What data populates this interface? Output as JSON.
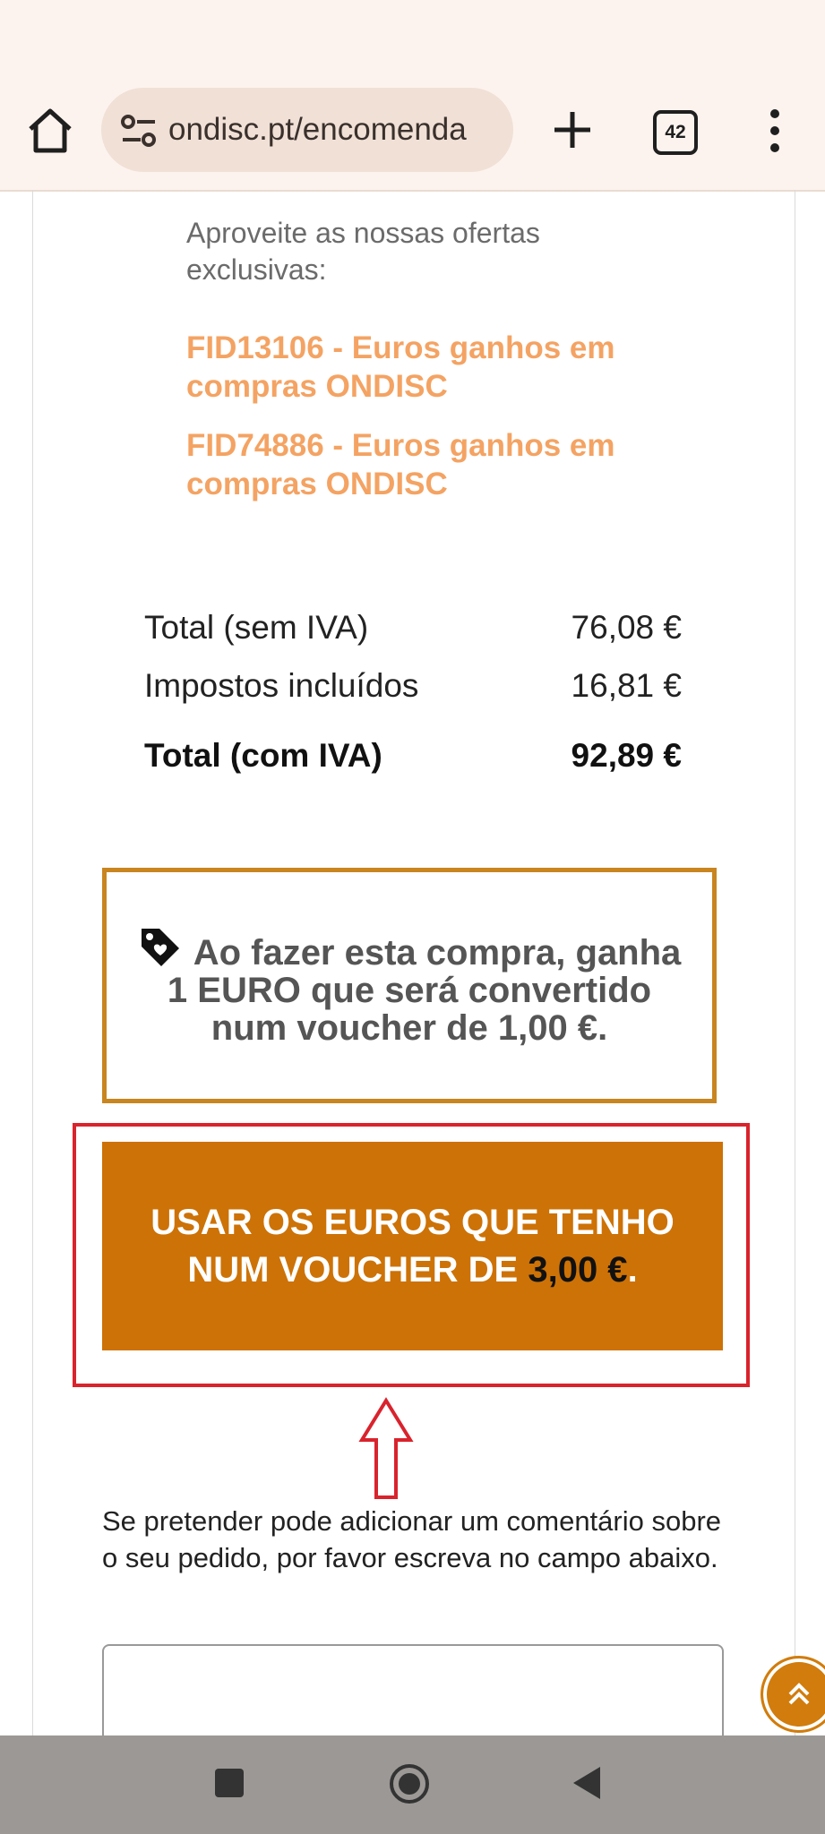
{
  "browser": {
    "url": "ondisc.pt/encomenda",
    "tab_count": "42"
  },
  "offers": {
    "intro": "Aproveite as nossas ofertas exclusivas:",
    "items": [
      {
        "label": "FID13106 - Euros ganhos em compras ONDISC"
      },
      {
        "label": "FID74886 - Euros ganhos em compras ONDISC"
      }
    ]
  },
  "totals": {
    "net_label": "Total (sem IVA)",
    "net_value": "76,08 €",
    "tax_label": "Impostos incluídos",
    "tax_value": "16,81 €",
    "gross_label": "Total (com IVA)",
    "gross_value": "92,89 €"
  },
  "earn_notice": {
    "text": "Ao fazer esta compra, ganha 1 EURO que será convertido num voucher de 1,00 €."
  },
  "voucher_button": {
    "label": "USAR OS EUROS QUE TENHO NUM VOUCHER DE",
    "amount": "3,00 €",
    "suffix": "."
  },
  "comment": {
    "help": "Se pretender pode adicionar um comentário sobre o seu pedido, por favor escreva no campo abaixo.",
    "value": ""
  },
  "colors": {
    "accent_orange": "#cd7206",
    "offer_orange": "#f4a363",
    "notice_border": "#c9851f",
    "highlight_red": "#d9232d"
  }
}
